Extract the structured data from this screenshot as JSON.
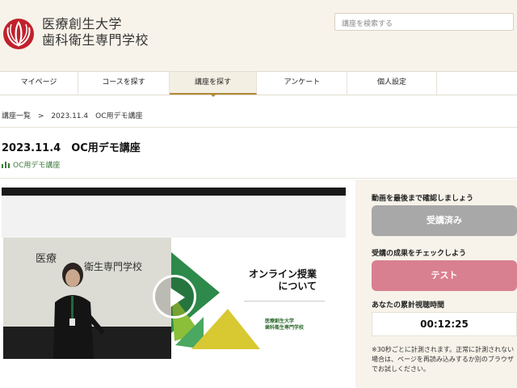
{
  "header": {
    "brand_line1": "医療創生大学",
    "brand_line2": "歯科衛生専門学校",
    "search_placeholder": "講座を検索する"
  },
  "nav": [
    "マイページ",
    "コースを探す",
    "講座を探す",
    "アンケート",
    "個人設定"
  ],
  "nav_active_index": 2,
  "breadcrumb": {
    "root": "講座一覧",
    "sep": ">",
    "current": "2023.11.4　OC用デモ講座"
  },
  "page": {
    "title": "2023.11.4　OC用デモ講座",
    "subtitle": "OC用デモ講座"
  },
  "video": {
    "slide_title_line1": "オンライン授業",
    "slide_title_line2": "について",
    "slide_sub_line1": "医療創生大学",
    "slide_sub_line2": "歯科衛生専門学校"
  },
  "sidebar": {
    "check_label": "動画を最後まで確認しましょう",
    "done_button": "受講済み",
    "result_label": "受講の成果をチェックしよう",
    "test_button": "テスト",
    "time_label": "あなたの累計視聴時間",
    "time_value": "00:12:25",
    "note": "※30秒ごとに計測されます。正常に計測されない場合は、ページを再読み込みするか別のブラウザでお試しください。"
  },
  "colors": {
    "accent": "#b08a3a",
    "logo_red": "#c0222c",
    "test_pink": "#d98090",
    "done_gray": "#a8a8a8",
    "slide_green": "#2d8a4a",
    "slide_yellow": "#d8c832"
  }
}
